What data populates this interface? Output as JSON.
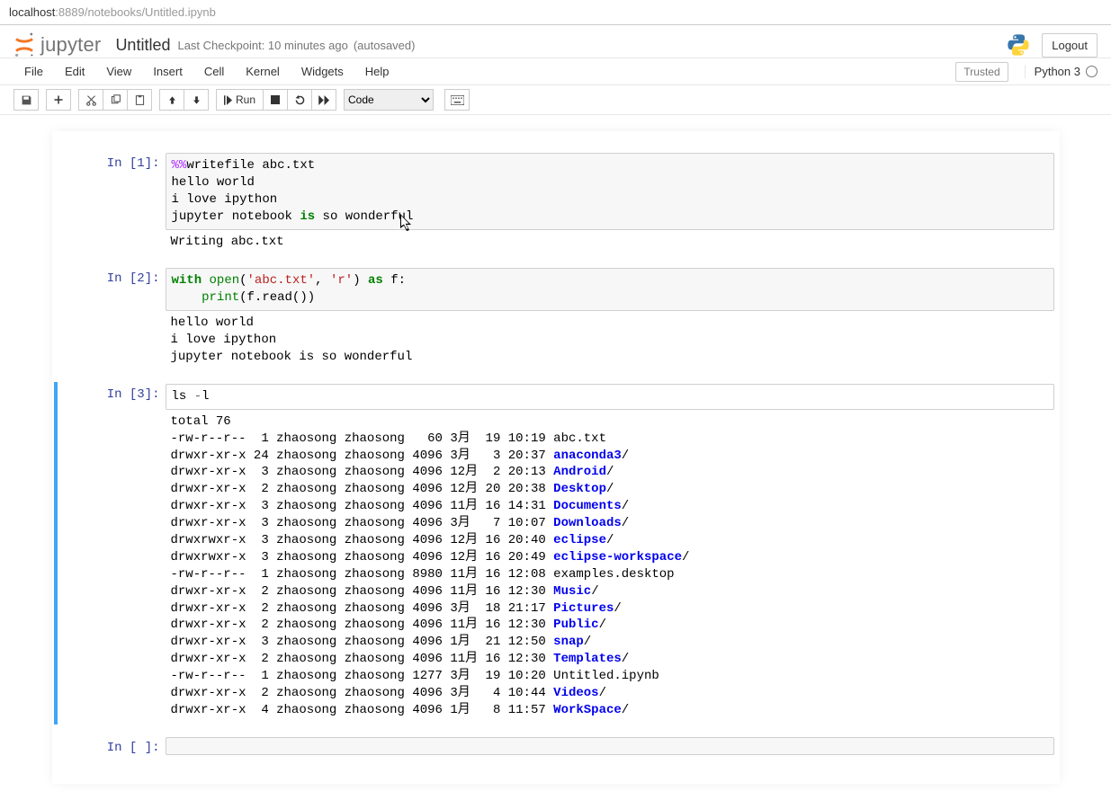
{
  "addr": {
    "host": "localhost",
    "path": ":8889/notebooks/Untitled.ipynb"
  },
  "header": {
    "logo_text": "jupyter",
    "notebook_name": "Untitled",
    "checkpoint": "Last Checkpoint: 10 minutes ago",
    "autosave": "(autosaved)",
    "logout": "Logout"
  },
  "menu": {
    "file": "File",
    "edit": "Edit",
    "view": "View",
    "insert": "Insert",
    "cell": "Cell",
    "kernel": "Kernel",
    "widgets": "Widgets",
    "help": "Help"
  },
  "trusted": "Trusted",
  "kernel_name": "Python 3",
  "toolbar": {
    "run": "Run",
    "celltype": "Code"
  },
  "cells": [
    {
      "prompt": "In [1]:",
      "code_raw": "%%writefile abc.txt\nhello world\ni love ipython\njupyter notebook is so wonderful",
      "out": "Writing abc.txt"
    },
    {
      "prompt": "In [2]:",
      "code_raw": "with open('abc.txt', 'r') as f:\n    print(f.read())",
      "out": "hello world\ni love ipython\njupyter notebook is so wonderful"
    },
    {
      "prompt": "In [3]:",
      "code_raw": "ls -l",
      "ls": [
        {
          "pre": "total 76"
        },
        {
          "pre": "-rw-r--r--  1 zhaosong zhaosong   60 3月  19 10:19 abc.txt"
        },
        {
          "pre": "drwxr-xr-x 24 zhaosong zhaosong 4096 3月   3 20:37 ",
          "dir": "anaconda3",
          "suf": "/"
        },
        {
          "pre": "drwxr-xr-x  3 zhaosong zhaosong 4096 12月  2 20:13 ",
          "dir": "Android",
          "suf": "/"
        },
        {
          "pre": "drwxr-xr-x  2 zhaosong zhaosong 4096 12月 20 20:38 ",
          "dir": "Desktop",
          "suf": "/"
        },
        {
          "pre": "drwxr-xr-x  3 zhaosong zhaosong 4096 11月 16 14:31 ",
          "dir": "Documents",
          "suf": "/"
        },
        {
          "pre": "drwxr-xr-x  3 zhaosong zhaosong 4096 3月   7 10:07 ",
          "dir": "Downloads",
          "suf": "/"
        },
        {
          "pre": "drwxrwxr-x  3 zhaosong zhaosong 4096 12月 16 20:40 ",
          "dir": "eclipse",
          "suf": "/"
        },
        {
          "pre": "drwxrwxr-x  3 zhaosong zhaosong 4096 12月 16 20:49 ",
          "dir": "eclipse-workspace",
          "suf": "/"
        },
        {
          "pre": "-rw-r--r--  1 zhaosong zhaosong 8980 11月 16 12:08 examples.desktop"
        },
        {
          "pre": "drwxr-xr-x  2 zhaosong zhaosong 4096 11月 16 12:30 ",
          "dir": "Music",
          "suf": "/"
        },
        {
          "pre": "drwxr-xr-x  2 zhaosong zhaosong 4096 3月  18 21:17 ",
          "dir": "Pictures",
          "suf": "/"
        },
        {
          "pre": "drwxr-xr-x  2 zhaosong zhaosong 4096 11月 16 12:30 ",
          "dir": "Public",
          "suf": "/"
        },
        {
          "pre": "drwxr-xr-x  3 zhaosong zhaosong 4096 1月  21 12:50 ",
          "dir": "snap",
          "suf": "/"
        },
        {
          "pre": "drwxr-xr-x  2 zhaosong zhaosong 4096 11月 16 12:30 ",
          "dir": "Templates",
          "suf": "/"
        },
        {
          "pre": "-rw-r--r--  1 zhaosong zhaosong 1277 3月  19 10:20 Untitled.ipynb"
        },
        {
          "pre": "drwxr-xr-x  2 zhaosong zhaosong 4096 3月   4 10:44 ",
          "dir": "Videos",
          "suf": "/"
        },
        {
          "pre": "drwxr-xr-x  4 zhaosong zhaosong 4096 1月   8 11:57 ",
          "dir": "WorkSpace",
          "suf": "/"
        }
      ]
    },
    {
      "prompt": "In [ ]:",
      "code_raw": ""
    }
  ]
}
